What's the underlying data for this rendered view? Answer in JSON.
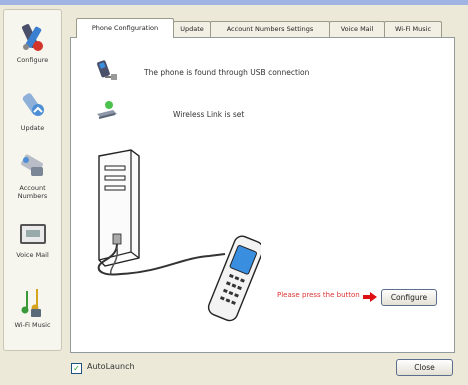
{
  "sidebar": {
    "items": [
      {
        "label": "Configure"
      },
      {
        "label": "Update"
      },
      {
        "label": "Account Numbers"
      },
      {
        "label": "Voice Mail"
      },
      {
        "label": "Wi-Fi Music"
      }
    ]
  },
  "tabs": [
    {
      "label": "Phone Configuration",
      "active": true
    },
    {
      "label": "Update",
      "active": false
    },
    {
      "label": "Account Numbers Settings",
      "active": false
    },
    {
      "label": "Voice Mail",
      "active": false
    },
    {
      "label": "Wi-Fi Music",
      "active": false
    }
  ],
  "status": {
    "usb_line": "The phone is found through USB connection",
    "wireless_line": "Wireless Link is set"
  },
  "configure": {
    "hint": "Please press the button",
    "button_label": "Configure"
  },
  "footer": {
    "autolaunch_label": "AutoLaunch",
    "autolaunch_checked": true,
    "close_label": "Close"
  },
  "colors": {
    "hint_text": "#dd3333",
    "arrow": "#dd1111",
    "phone_screen": "#3a8ee0",
    "window_bg": "#ece9d8"
  }
}
